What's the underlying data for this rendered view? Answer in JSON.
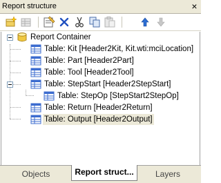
{
  "window": {
    "title": "Report structure",
    "close_glyph": "×"
  },
  "toolbar": {
    "buttons": [
      {
        "name": "add-container-icon"
      },
      {
        "name": "add-table-icon"
      },
      {
        "name": "properties-icon"
      },
      {
        "name": "delete-icon"
      },
      {
        "name": "cut-icon"
      },
      {
        "name": "copy-icon"
      },
      {
        "name": "paste-icon"
      },
      {
        "name": "move-up-icon"
      },
      {
        "name": "move-down-icon"
      }
    ]
  },
  "tree": {
    "root": {
      "label": "Report Container",
      "expanded": true
    },
    "items": [
      {
        "label": "Table: Kit [Header2Kit, Kit.wti:mciLocation]",
        "level": 1
      },
      {
        "label": "Table: Part [Header2Part]",
        "level": 1
      },
      {
        "label": "Table: Tool [Header2Tool]",
        "level": 1
      },
      {
        "label": "Table: StepStart [Header2StepStart]",
        "level": 1,
        "expanded": true
      },
      {
        "label": "Table: StepOp [StepStart2StepOp]",
        "level": 2
      },
      {
        "label": "Table: Return [Header2Return]",
        "level": 1
      },
      {
        "label": "Table: Output [Header2Output]",
        "level": 1,
        "selected": true
      }
    ]
  },
  "tabs": [
    {
      "label": "Objects"
    },
    {
      "label": "Report struct...",
      "active": true
    },
    {
      "label": "Layers"
    }
  ]
}
